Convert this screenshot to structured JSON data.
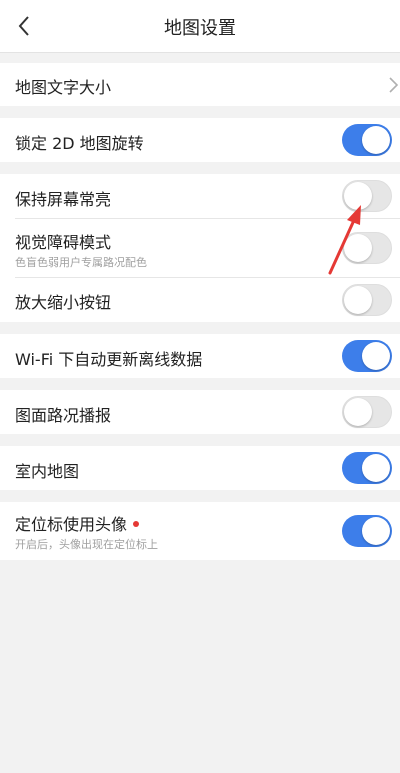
{
  "nav": {
    "title": "地图设置",
    "back_icon": "chevron-left-icon"
  },
  "rows": {
    "font_size": {
      "label": "地图文字大小",
      "icon": "chevron-right-icon"
    },
    "lock_2d": {
      "label": "锁定 2D 地图旋转",
      "enabled": true
    },
    "keep_screen_on": {
      "label": "保持屏幕常亮",
      "enabled": false
    },
    "vision_mode": {
      "label": "视觉障碍模式",
      "sublabel": "色盲色弱用户专属路况配色",
      "enabled": false
    },
    "zoom_buttons": {
      "label": "放大缩小按钮",
      "enabled": false
    },
    "wifi_update": {
      "label": "Wi-Fi 下自动更新离线数据",
      "enabled": true
    },
    "traffic_broadcast": {
      "label": "图面路况播报",
      "enabled": false
    },
    "indoor_map": {
      "label": "室内地图",
      "enabled": true
    },
    "avatar_locator": {
      "label": "定位标使用头像",
      "sublabel": "开启后，头像出现在定位标上",
      "enabled": true
    }
  },
  "colors": {
    "toggle_on": "#3d7eea",
    "toggle_off": "#e6e6e6",
    "annotation_arrow": "#e53935",
    "new_dot": "#e53935"
  }
}
